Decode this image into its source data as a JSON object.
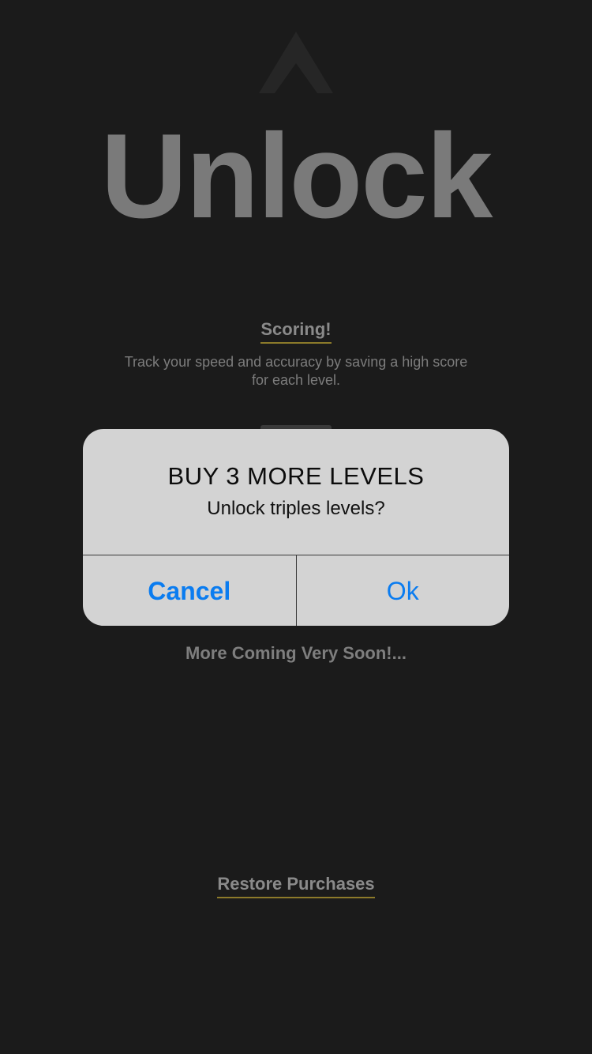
{
  "page": {
    "title": "Unlock",
    "back_icon": "chevron-up-icon"
  },
  "features": [
    {
      "heading": "Scoring!",
      "description": "Track your speed and accuracy by saving a high score for each level."
    }
  ],
  "more_coming": "More Coming Very Soon!...",
  "restore_purchases": "Restore Purchases",
  "alert": {
    "title": "BUY 3 MORE LEVELS",
    "message": "Unlock triples levels?",
    "cancel_label": "Cancel",
    "ok_label": "Ok"
  },
  "colors": {
    "background": "#1b1b1b",
    "accent_underline": "#8c7a2a",
    "alert_background": "#d3d3d3",
    "alert_button": "#0a7cf0"
  }
}
